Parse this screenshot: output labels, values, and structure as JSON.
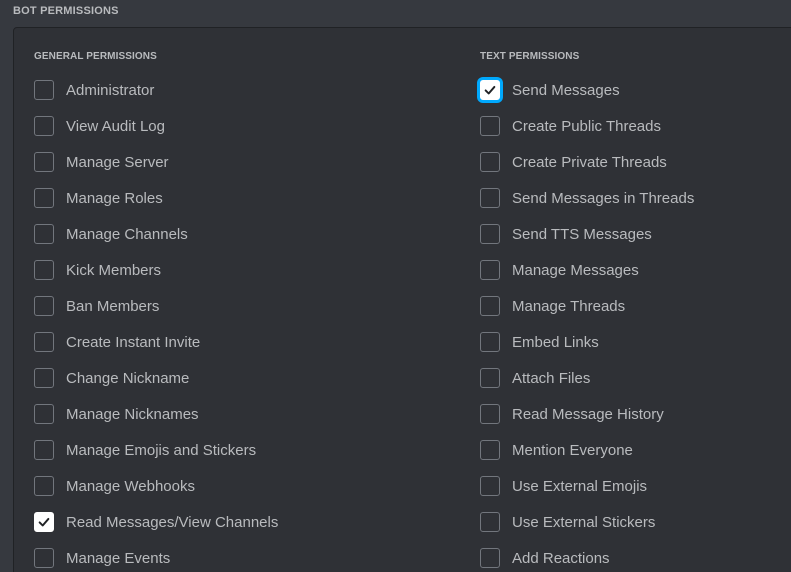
{
  "section_title": "BOT PERMISSIONS",
  "columns": [
    {
      "title": "GENERAL PERMISSIONS",
      "items": [
        {
          "label": "Administrator",
          "checked": false
        },
        {
          "label": "View Audit Log",
          "checked": false
        },
        {
          "label": "Manage Server",
          "checked": false
        },
        {
          "label": "Manage Roles",
          "checked": false
        },
        {
          "label": "Manage Channels",
          "checked": false
        },
        {
          "label": "Kick Members",
          "checked": false
        },
        {
          "label": "Ban Members",
          "checked": false
        },
        {
          "label": "Create Instant Invite",
          "checked": false
        },
        {
          "label": "Change Nickname",
          "checked": false
        },
        {
          "label": "Manage Nicknames",
          "checked": false
        },
        {
          "label": "Manage Emojis and Stickers",
          "checked": false
        },
        {
          "label": "Manage Webhooks",
          "checked": false
        },
        {
          "label": "Read Messages/View Channels",
          "checked": true
        },
        {
          "label": "Manage Events",
          "checked": false
        }
      ]
    },
    {
      "title": "TEXT PERMISSIONS",
      "items": [
        {
          "label": "Send Messages",
          "checked": true,
          "focused": true
        },
        {
          "label": "Create Public Threads",
          "checked": false
        },
        {
          "label": "Create Private Threads",
          "checked": false
        },
        {
          "label": "Send Messages in Threads",
          "checked": false
        },
        {
          "label": "Send TTS Messages",
          "checked": false
        },
        {
          "label": "Manage Messages",
          "checked": false
        },
        {
          "label": "Manage Threads",
          "checked": false
        },
        {
          "label": "Embed Links",
          "checked": false
        },
        {
          "label": "Attach Files",
          "checked": false
        },
        {
          "label": "Read Message History",
          "checked": false
        },
        {
          "label": "Mention Everyone",
          "checked": false
        },
        {
          "label": "Use External Emojis",
          "checked": false
        },
        {
          "label": "Use External Stickers",
          "checked": false
        },
        {
          "label": "Add Reactions",
          "checked": false
        }
      ]
    }
  ],
  "colors": {
    "background": "#36393f",
    "panel": "#2f3136",
    "text": "#b9bbbe",
    "checkbox_border": "#72767d",
    "checked_fill": "#ffffff",
    "focus_ring": "#00a8fc"
  },
  "icons": {
    "checked": "checkmark-icon"
  }
}
